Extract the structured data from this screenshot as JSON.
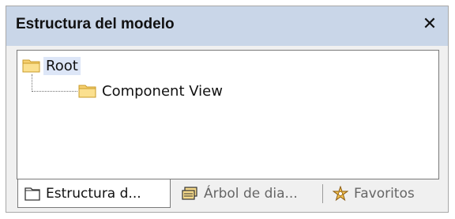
{
  "panel": {
    "title": "Estructura del modelo",
    "close_symbol": "✕",
    "accent_color": "#c9d6e8"
  },
  "tree": {
    "root": {
      "label": "Root",
      "icon": "folder-icon"
    },
    "children": [
      {
        "label": "Component View",
        "icon": "folder-icon"
      }
    ]
  },
  "tabs": [
    {
      "label": "Estructura d...",
      "icon": "model-tree-icon",
      "active": true
    },
    {
      "label": "Árbol de dia...",
      "icon": "diagram-tree-icon",
      "active": false
    },
    {
      "label": "Favoritos",
      "icon": "favorites-icon",
      "active": false
    }
  ]
}
